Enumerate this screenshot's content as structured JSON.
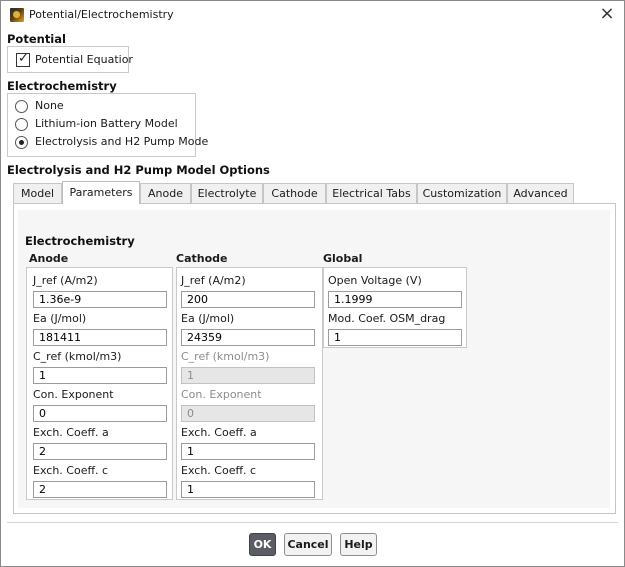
{
  "window": {
    "title": "Potential/Electrochemistry",
    "close_label": "×"
  },
  "potential": {
    "heading": "Potential",
    "checkbox_label": "Potential Equatior",
    "checked": true
  },
  "electrochemistry": {
    "heading": "Electrochemistry",
    "options": [
      {
        "label": "None",
        "selected": false
      },
      {
        "label": "Lithium-ion Battery Model",
        "selected": false
      },
      {
        "label": "Electrolysis and H2 Pump Mode",
        "selected": true
      }
    ]
  },
  "options_heading": "Electrolysis and H2 Pump Model Options",
  "tabs": [
    {
      "label": "Model",
      "active": false
    },
    {
      "label": "Parameters",
      "active": true
    },
    {
      "label": "Anode",
      "active": false
    },
    {
      "label": "Electrolyte",
      "active": false
    },
    {
      "label": "Cathode",
      "active": false
    },
    {
      "label": "Electrical Tabs",
      "active": false
    },
    {
      "label": "Customization",
      "active": false
    },
    {
      "label": "Advanced",
      "active": false
    }
  ],
  "panel": {
    "heading": "Electrochemistry",
    "anode": {
      "header": "Anode",
      "fields": [
        {
          "label": "J_ref (A/m2)",
          "value": "1.36e-9",
          "disabled": false
        },
        {
          "label": "Ea (J/mol)",
          "value": "181411",
          "disabled": false
        },
        {
          "label": "C_ref (kmol/m3)",
          "value": "1",
          "disabled": false
        },
        {
          "label": "Con. Exponent",
          "value": "0",
          "disabled": false
        },
        {
          "label": "Exch. Coeff. a",
          "value": "2",
          "disabled": false
        },
        {
          "label": "Exch. Coeff. c",
          "value": "2",
          "disabled": false
        }
      ]
    },
    "cathode": {
      "header": "Cathode",
      "fields": [
        {
          "label": "J_ref (A/m2)",
          "value": "200",
          "disabled": false
        },
        {
          "label": "Ea (J/mol)",
          "value": "24359",
          "disabled": false
        },
        {
          "label": "C_ref (kmol/m3)",
          "value": "1",
          "disabled": true
        },
        {
          "label": "Con. Exponent",
          "value": "0",
          "disabled": true
        },
        {
          "label": "Exch. Coeff. a",
          "value": "1",
          "disabled": false
        },
        {
          "label": "Exch. Coeff. c",
          "value": "1",
          "disabled": false
        }
      ]
    },
    "global": {
      "header": "Global",
      "fields": [
        {
          "label": "Open Voltage (V)",
          "value": "1.1999",
          "disabled": false
        },
        {
          "label": "Mod. Coef. OSM_drag",
          "value": "1",
          "disabled": false
        }
      ]
    }
  },
  "buttons": {
    "ok": "OK",
    "cancel": "Cancel",
    "help": "Help"
  }
}
